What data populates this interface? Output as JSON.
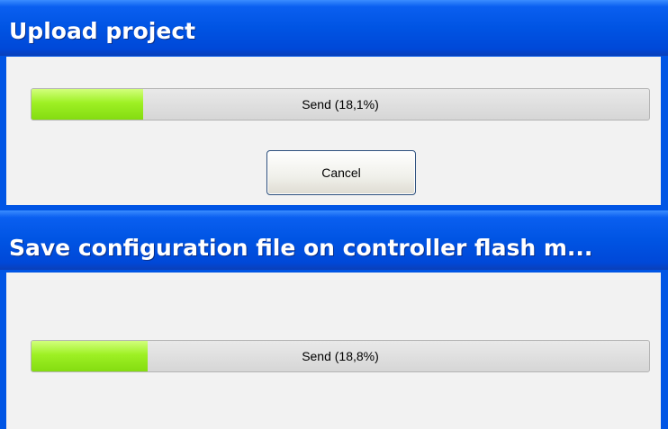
{
  "upload_dialog": {
    "title": "Upload project",
    "progress": {
      "label": "Send (18,1%)",
      "fraction": 0.181
    },
    "cancel_label": "Cancel"
  },
  "save_dialog": {
    "title": "Save configuration file on controller flash m...",
    "progress": {
      "label": "Send (18,8%)",
      "fraction": 0.188
    }
  },
  "colors": {
    "titlebar": "#0054e3",
    "client": "#f2f2f2",
    "progress_fill": "#9ef024",
    "progress_track": "#dcdcdc"
  }
}
